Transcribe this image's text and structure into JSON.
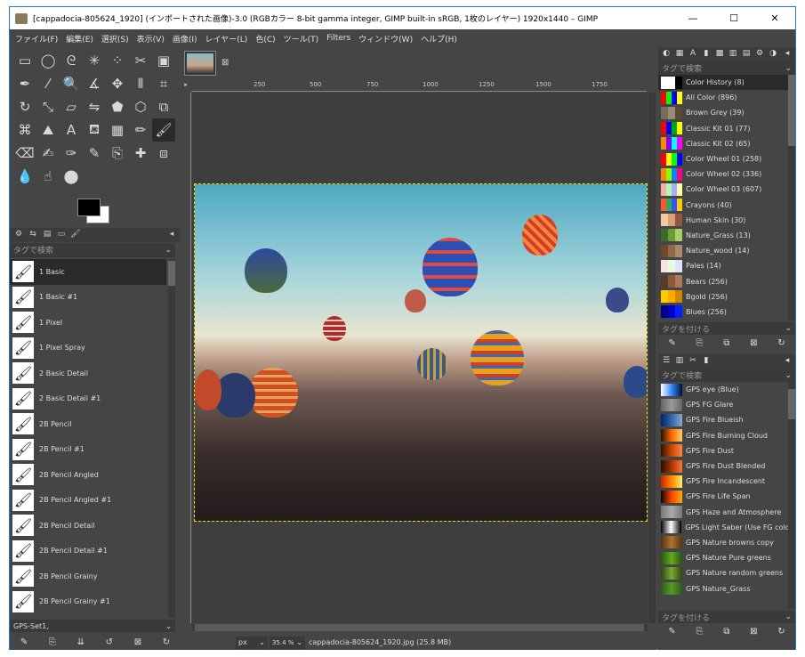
{
  "titlebar": {
    "title": "[cappadocia-805624_1920] (インポートされた画像)-3.0 (RGBカラー 8-bit gamma integer, GIMP built-in sRGB, 1枚のレイヤー) 1920x1440 – GIMP",
    "minimize": "—",
    "maximize": "☐",
    "close": "✕"
  },
  "menu": [
    "ファイル(F)",
    "編集(E)",
    "選択(S)",
    "表示(V)",
    "画像(I)",
    "レイヤー(L)",
    "色(C)",
    "ツール(T)",
    "Filters",
    "ウィンドウ(W)",
    "ヘルプ(H)"
  ],
  "tools": [
    {
      "icon": "rect-select-icon",
      "glyph": "▭"
    },
    {
      "icon": "ellipse-select-icon",
      "glyph": "◯"
    },
    {
      "icon": "free-select-icon",
      "glyph": "ᘓ"
    },
    {
      "icon": "fuzzy-select-icon",
      "glyph": "✳"
    },
    {
      "icon": "select-by-color-icon",
      "glyph": "⁘"
    },
    {
      "icon": "scissors-select-icon",
      "glyph": "✂"
    },
    {
      "icon": "foreground-select-icon",
      "glyph": "▣"
    },
    {
      "icon": "paths-icon",
      "glyph": "✒"
    },
    {
      "icon": "color-picker-icon",
      "glyph": "⁄"
    },
    {
      "icon": "zoom-icon",
      "glyph": "🔍"
    },
    {
      "icon": "measure-icon",
      "glyph": "∡"
    },
    {
      "icon": "move-icon",
      "glyph": "✥"
    },
    {
      "icon": "align-icon",
      "glyph": "⫴"
    },
    {
      "icon": "crop-icon",
      "glyph": "⌗"
    },
    {
      "icon": "rotate-icon",
      "glyph": "↻"
    },
    {
      "icon": "scale-icon",
      "glyph": "⤡"
    },
    {
      "icon": "shear-icon",
      "glyph": "▱"
    },
    {
      "icon": "flip-icon",
      "glyph": "⇋"
    },
    {
      "icon": "perspective-icon",
      "glyph": "⬟"
    },
    {
      "icon": "3d-transform-icon",
      "glyph": "⬡"
    },
    {
      "icon": "unified-transform-icon",
      "glyph": "⧉"
    },
    {
      "icon": "warp-transform-icon",
      "glyph": "⌘"
    },
    {
      "icon": "handle-transform-icon",
      "glyph": "⛰"
    },
    {
      "icon": "text-icon",
      "glyph": "A"
    },
    {
      "icon": "bucket-fill-icon",
      "glyph": "⛾"
    },
    {
      "icon": "gradient-icon",
      "glyph": "▦"
    },
    {
      "icon": "pencil-icon",
      "glyph": "✏"
    },
    {
      "icon": "paintbrush-icon",
      "glyph": "🖌"
    },
    {
      "icon": "eraser-icon",
      "glyph": "⌫"
    },
    {
      "icon": "airbrush-icon",
      "glyph": "✍"
    },
    {
      "icon": "ink-icon",
      "glyph": "✑"
    },
    {
      "icon": "mypaint-brush-icon",
      "glyph": "✎"
    },
    {
      "icon": "clone-icon",
      "glyph": "⎘"
    },
    {
      "icon": "heal-icon",
      "glyph": "✚"
    },
    {
      "icon": "perspective-clone-icon",
      "glyph": "⧈"
    },
    {
      "icon": "blur-icon",
      "glyph": "💧"
    },
    {
      "icon": "smudge-icon",
      "glyph": "☝"
    },
    {
      "icon": "dodge-burn-icon",
      "glyph": "⬤"
    }
  ],
  "brushes": {
    "filter_placeholder": "タグで検索",
    "items": [
      "1 Basic",
      "1 Basic #1",
      "1 Pixel",
      "1 Pixel Spray",
      "2 Basic Detail",
      "2 Basic Detail #1",
      "2B Pencil",
      "2B Pencil #1",
      "2B Pencil Angled",
      "2B Pencil Angled #1",
      "2B Pencil Detail",
      "2B Pencil Detail #1",
      "2B Pencil Grainy",
      "2B Pencil Grainy #1"
    ],
    "set": "GPS-Set1,"
  },
  "ruler_labels": [
    "250",
    "500",
    "750",
    "1000",
    "1250",
    "1500",
    "1750"
  ],
  "status": {
    "unit": "px",
    "zoom": "35.4 %",
    "file": "cappadocia-805624_1920.jpg (25.8 MB)"
  },
  "palettes": {
    "filter_placeholder": "タグで検索",
    "tag_placeholder": "タグを付ける",
    "items": [
      {
        "name": "Color History (8)",
        "colors": [
          "#ffffff",
          "#ffffff",
          "#000000"
        ]
      },
      {
        "name": "All Color (896)",
        "colors": [
          "#ff0000",
          "#00ff00",
          "#0000ff",
          "#ffff00"
        ]
      },
      {
        "name": "Brown Grey (39)",
        "colors": [
          "#7a6a5a",
          "#9a8a7a",
          "#5a4a3a"
        ]
      },
      {
        "name": "Classic Kit 01 (77)",
        "colors": [
          "#ff0000",
          "#0000ff",
          "#00aa00",
          "#ffff00"
        ]
      },
      {
        "name": "Classic Kit 02 (65)",
        "colors": [
          "#ff8800",
          "#8800ff",
          "#00ffff",
          "#ff00ff"
        ]
      },
      {
        "name": "Color Wheel 01 (258)",
        "colors": [
          "#ff0000",
          "#ffff00",
          "#00ff00",
          "#0000ff"
        ]
      },
      {
        "name": "Color Wheel 02 (336)",
        "colors": [
          "#ff8800",
          "#88ff00",
          "#0088ff",
          "#ff0088"
        ]
      },
      {
        "name": "Color Wheel 03 (607)",
        "colors": [
          "#ffaaaa",
          "#aaffaa",
          "#aaaaff",
          "#ffffaa"
        ]
      },
      {
        "name": "Crayons (40)",
        "colors": [
          "#ff5533",
          "#33aa55",
          "#3355ff",
          "#ffcc00"
        ]
      },
      {
        "name": "Human Skin (30)",
        "colors": [
          "#f2c9a6",
          "#d9a07a",
          "#8c5a3c"
        ]
      },
      {
        "name": "Nature_Grass (13)",
        "colors": [
          "#3a6a2a",
          "#6a9a3a",
          "#aacc66"
        ]
      },
      {
        "name": "Nature_wood (14)",
        "colors": [
          "#6a4a2a",
          "#8a6a4a",
          "#aa8a6a"
        ]
      },
      {
        "name": "Pales (14)",
        "colors": [
          "#ffe0e0",
          "#e0ffe0",
          "#e0e0ff"
        ]
      },
      {
        "name": "Bears (256)",
        "colors": [
          "#5a3a2a",
          "#8a5a3a",
          "#aa7a5a"
        ]
      },
      {
        "name": "Bgold (256)",
        "colors": [
          "#ffcc00",
          "#ffaa00",
          "#cc8800"
        ]
      },
      {
        "name": "Blues (256)",
        "colors": [
          "#000088",
          "#0000cc",
          "#0022ff"
        ]
      }
    ]
  },
  "gradients": {
    "filter_placeholder": "タグで検索",
    "tag_placeholder": "タグを付ける",
    "items": [
      {
        "name": "GPS eye (Blue)",
        "colors": [
          "#ffffff",
          "#3388ff",
          "#001133"
        ]
      },
      {
        "name": "GPS FG Glare",
        "colors": [
          "#666666",
          "#999999",
          "#666666"
        ]
      },
      {
        "name": "GPS Fire Blueish",
        "colors": [
          "#002266",
          "#3366aa",
          "#88aacc"
        ]
      },
      {
        "name": "GPS Fire Burning Cloud",
        "colors": [
          "#221100",
          "#ff6600",
          "#ffcc66"
        ]
      },
      {
        "name": "GPS Fire Dust",
        "colors": [
          "#331100",
          "#cc4400",
          "#ff8844"
        ]
      },
      {
        "name": "GPS Fire Dust Blended",
        "colors": [
          "#221100",
          "#aa3300",
          "#ff7733"
        ]
      },
      {
        "name": "GPS Fire Incandescent",
        "colors": [
          "#cc2200",
          "#ff8800",
          "#ffee66"
        ]
      },
      {
        "name": "GPS Fire Life Span",
        "colors": [
          "#110000",
          "#ff4400",
          "#ffaa00"
        ]
      },
      {
        "name": "GPS Haze and Atmosphere",
        "colors": [
          "#777777",
          "#aaaaaa",
          "#777777"
        ]
      },
      {
        "name": "GPS Light Saber (Use FG color)",
        "colors": [
          "#000000",
          "#ffffff",
          "#000000"
        ]
      },
      {
        "name": "GPS Nature browns copy",
        "colors": [
          "#553311",
          "#aa7733",
          "#553311"
        ]
      },
      {
        "name": "GPS Nature Pure greens",
        "colors": [
          "#225511",
          "#66aa22",
          "#225511"
        ]
      },
      {
        "name": "GPS Nature random greens",
        "colors": [
          "#334411",
          "#77aa33",
          "#334411"
        ]
      },
      {
        "name": "GPS Nature_Grass",
        "colors": [
          "#2a5a1a",
          "#5a9a2a",
          "#2a5a1a"
        ]
      }
    ]
  }
}
